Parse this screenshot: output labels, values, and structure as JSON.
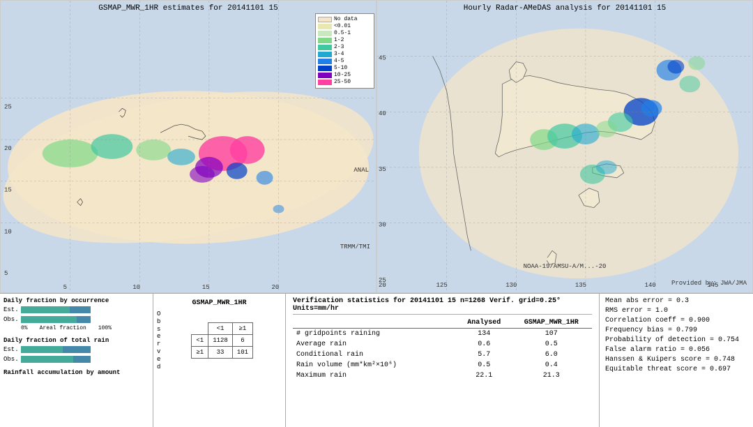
{
  "left_map": {
    "title": "GSMAP_MWR_1HR estimates for 20141101 15",
    "label_anal": "ANAL",
    "label_trmm": "TRMM/TMI"
  },
  "right_map": {
    "title": "Hourly Radar-AMeDAS analysis for 20141101 15",
    "label_noaa": "NOAA-19/AMSU-A/M...-20",
    "label_provided": "Provided by: JWA/JMA",
    "lat_labels": [
      "45",
      "40",
      "35",
      "30",
      "25",
      "20"
    ],
    "lon_labels": [
      "125",
      "130",
      "135",
      "140",
      "145"
    ]
  },
  "legend": {
    "title": "No data",
    "items": [
      {
        "color": "#f5e6c8",
        "label": "No data"
      },
      {
        "color": "#e8e8b0",
        "label": "<0.01"
      },
      {
        "color": "#c8e8c0",
        "label": "0.5-1"
      },
      {
        "color": "#80d888",
        "label": "1-2"
      },
      {
        "color": "#40c8a0",
        "label": "2-3"
      },
      {
        "color": "#20a8d0",
        "label": "3-4"
      },
      {
        "color": "#2080e8",
        "label": "4-5"
      },
      {
        "color": "#0040c8",
        "label": "5-10"
      },
      {
        "color": "#8000c0",
        "label": "10-25"
      },
      {
        "color": "#ff40a0",
        "label": "25-50"
      }
    ]
  },
  "charts": {
    "occurrence_title": "Daily fraction by occurrence",
    "rain_title": "Daily fraction of total rain",
    "amount_title": "Rainfall accumulation by amount",
    "est_label": "Est.",
    "obs_label": "Obs.",
    "axis_start": "0%",
    "axis_end": "Areal fraction",
    "axis_100": "100%"
  },
  "contingency": {
    "title": "GSMAP_MWR_1HR",
    "col_less": "<1",
    "col_more": "≥1",
    "row_less": "<1",
    "row_more": "≥1",
    "observed_label": "O\nb\ns\ne\nr\nv\ne\nd",
    "cells": {
      "a": "1128",
      "b": "6",
      "c": "33",
      "d": "101"
    }
  },
  "verification": {
    "title": "Verification statistics for 20141101 15  n=1268  Verif. grid=0.25°  Units=mm/hr",
    "col_analysed": "Analysed",
    "col_gsmap": "GSMAP_MWR_1HR",
    "divider": "---",
    "rows": [
      {
        "label": "# gridpoints raining",
        "analysed": "134",
        "gsmap": "107"
      },
      {
        "label": "Average rain",
        "analysed": "0.6",
        "gsmap": "0.5"
      },
      {
        "label": "Conditional rain",
        "analysed": "5.7",
        "gsmap": "6.0"
      },
      {
        "label": "Rain volume (mm*km²×10⁶)",
        "analysed": "0.5",
        "gsmap": "0.4"
      },
      {
        "label": "Maximum rain",
        "analysed": "22.1",
        "gsmap": "21.3"
      }
    ]
  },
  "scores": {
    "items": [
      {
        "label": "Mean abs error = 0.3"
      },
      {
        "label": "RMS error = 1.0"
      },
      {
        "label": "Correlation coeff = 0.900"
      },
      {
        "label": "Frequency bias = 0.799"
      },
      {
        "label": "Probability of detection = 0.754"
      },
      {
        "label": "False alarm ratio = 0.056"
      },
      {
        "label": "Hanssen & Kuipers score = 0.748"
      },
      {
        "label": "Equitable threat score = 0.697"
      }
    ]
  }
}
